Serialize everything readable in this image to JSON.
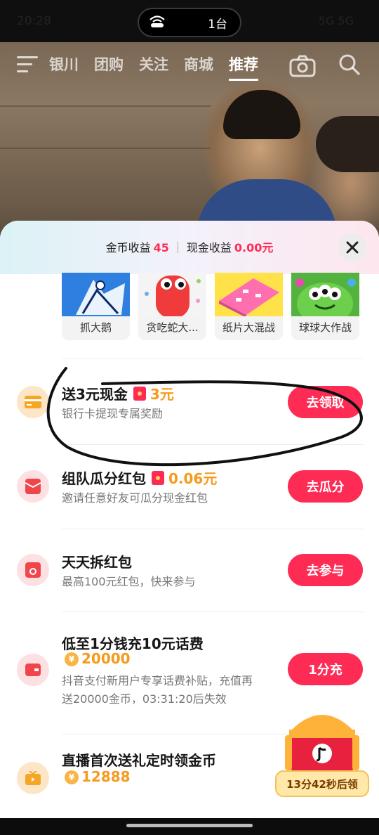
{
  "status_bar": {
    "time": "20:28",
    "cast_label": "1台",
    "right_info": "5G 5G"
  },
  "top_nav": {
    "tabs": [
      "银川",
      "团购",
      "关注",
      "商城",
      "推荐"
    ],
    "active_tab": "推荐"
  },
  "sheet": {
    "coin_label": "金币收益",
    "coin_value": "45",
    "cash_label": "现金收益",
    "cash_value": "0.00元"
  },
  "games": [
    {
      "name": "抓大鹅",
      "icon": "goose-game-icon"
    },
    {
      "name": "贪吃蛇大...",
      "icon": "snake-game-icon"
    },
    {
      "name": "纸片大混战",
      "icon": "paper-battle-game-icon"
    },
    {
      "name": "球球大作战",
      "icon": "ball-battle-game-icon"
    }
  ],
  "tasks": [
    {
      "title": "送3元现金",
      "reward": "3元",
      "desc": "银行卡提现专属奖励",
      "button": "去领取",
      "icon": "bank-card-icon"
    },
    {
      "title": "组队瓜分红包",
      "reward": "0.06元",
      "desc": "邀请任意好友可瓜分现金红包",
      "button": "去瓜分",
      "icon": "red-envelope-icon"
    },
    {
      "title": "天天拆红包",
      "desc": "最高100元红包，快来参与",
      "button": "去参与",
      "icon": "open-envelope-icon"
    },
    {
      "title": "低至1分钱充10元话费",
      "coins": "20000",
      "desc_line1": "抖音支付新用户专享话费补贴，充值再",
      "desc_line2": "送20000金币，03:31:20后失效",
      "button": "1分充",
      "icon": "wallet-icon"
    },
    {
      "title": "直播首次送礼定时领金币",
      "coins": "12888",
      "icon": "tv-icon"
    }
  ],
  "chest": {
    "timer": "13分42秒后领"
  },
  "colors": {
    "accent": "#fe2c55",
    "reward": "#f59a1c"
  }
}
